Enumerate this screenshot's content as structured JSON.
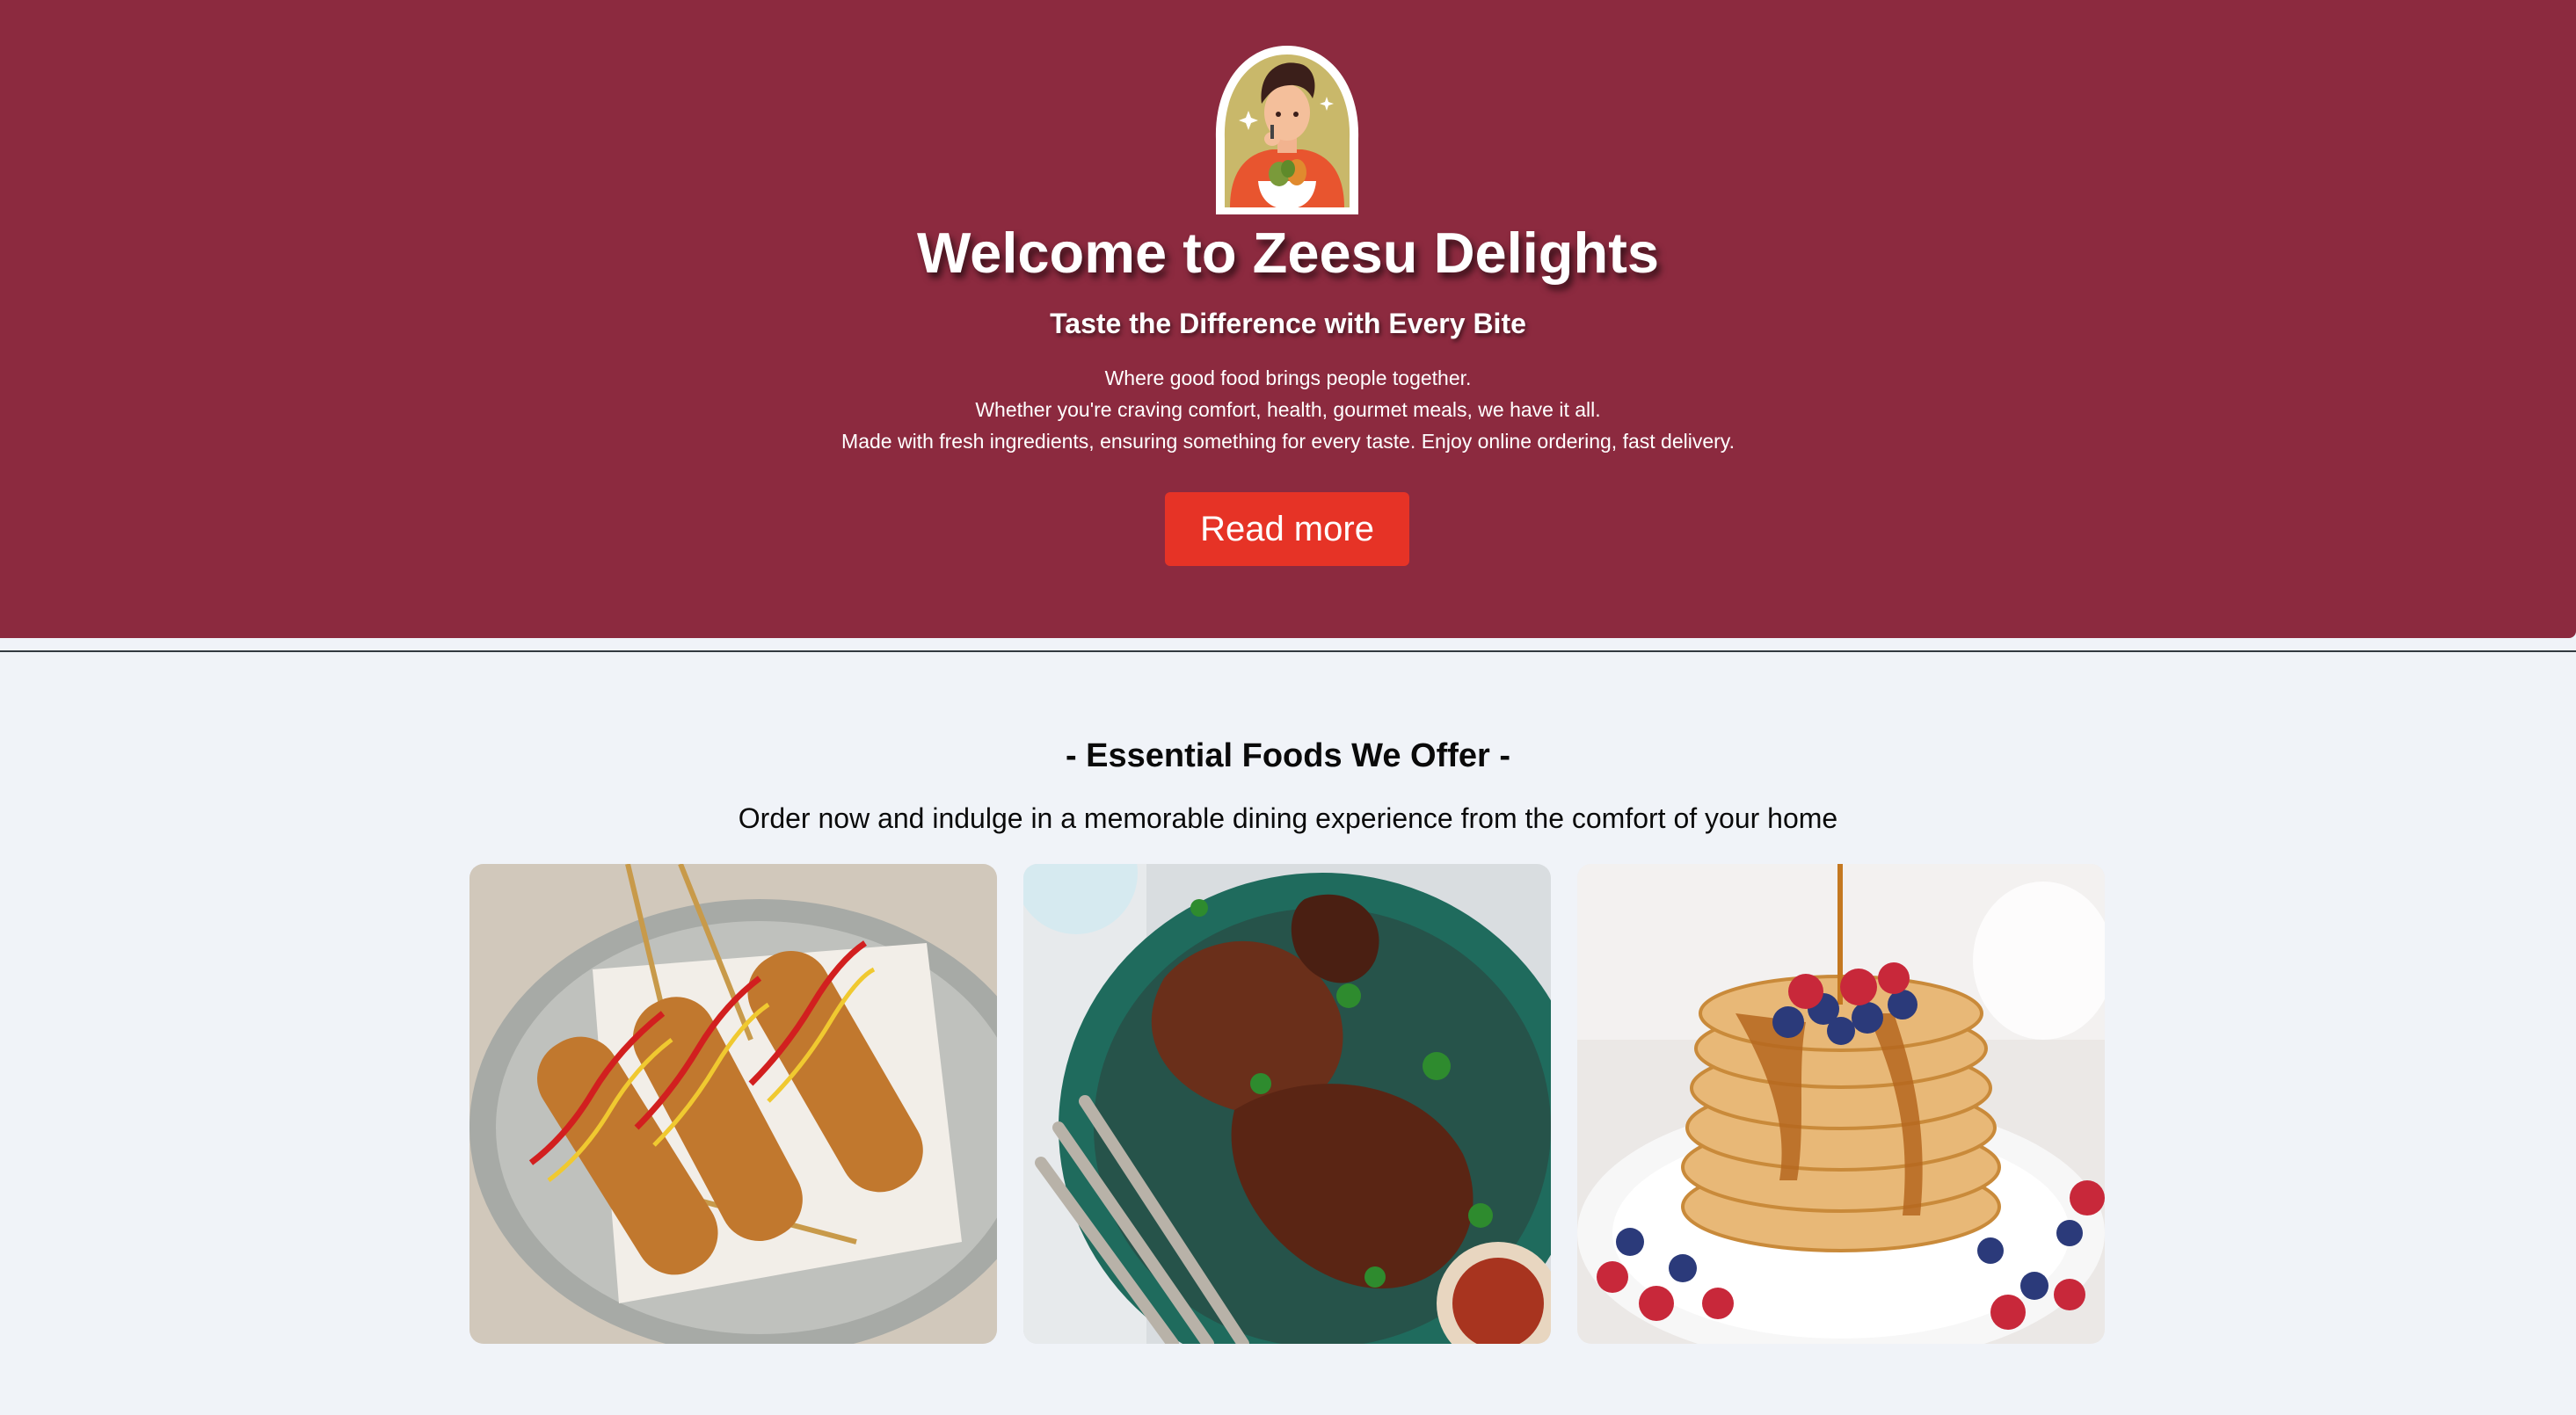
{
  "hero": {
    "logo_icon": "chef-eating-salad-logo",
    "title": "Welcome to Zeesu Delights",
    "subtitle": "Taste the Difference with Every Bite",
    "description_lines": [
      "Where good food brings people together.",
      "Whether you're craving comfort, health, gourmet meals, we have it all.",
      "Made with fresh ingredients, ensuring something for every taste. Enjoy online ordering, fast delivery."
    ],
    "button_label": "Read more",
    "background_color": "#8c2a3f",
    "button_color": "#e63326"
  },
  "offers": {
    "title": "- Essential Foods We Offer -",
    "subtitle": "Order now and indulge in a memorable dining experience from the comfort of your home",
    "cards": [
      {
        "image": "corn-dogs-photo"
      },
      {
        "image": "grilled-chicken-photo"
      },
      {
        "image": "berry-pancakes-photo"
      }
    ]
  }
}
